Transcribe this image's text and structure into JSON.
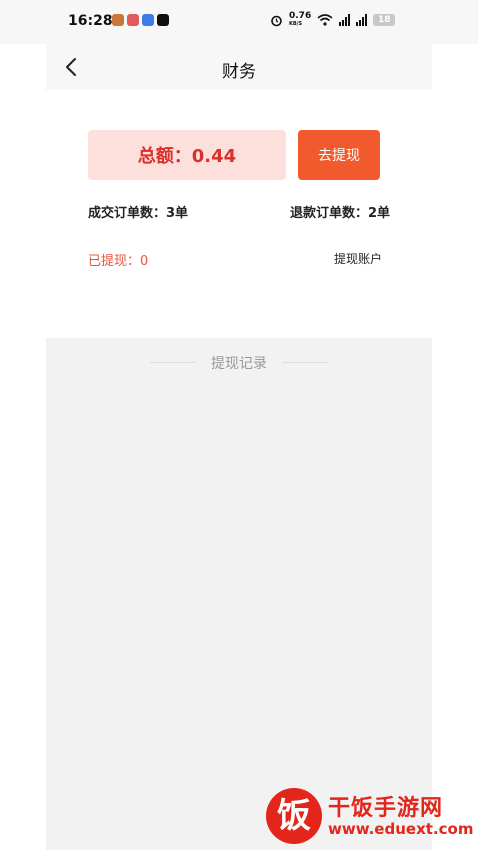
{
  "status_bar": {
    "time": "16:28",
    "net_speed": "0.76",
    "net_unit": "KB/S",
    "battery": "18",
    "app_icons": [
      "app-icon-orange",
      "app-icon-red",
      "app-icon-blue",
      "tiktok-icon"
    ]
  },
  "nav": {
    "title": "财务"
  },
  "summary": {
    "total_label": "总额：0.44",
    "withdraw_button": "去提现",
    "deal_orders": "成交订单数：3单",
    "refund_orders": "退款订单数：2单",
    "withdrawn": "已提现：0",
    "account_link": "提现账户"
  },
  "records": {
    "heading": "提现记录"
  },
  "watermark": {
    "logo_char": "饭",
    "name": "干饭手游网",
    "url": "www.eduext.com"
  },
  "colors": {
    "accent": "#f05a2c",
    "total_text": "#d9302a",
    "total_bg": "#fde0dc",
    "withdrawn_text": "#e8553a"
  }
}
